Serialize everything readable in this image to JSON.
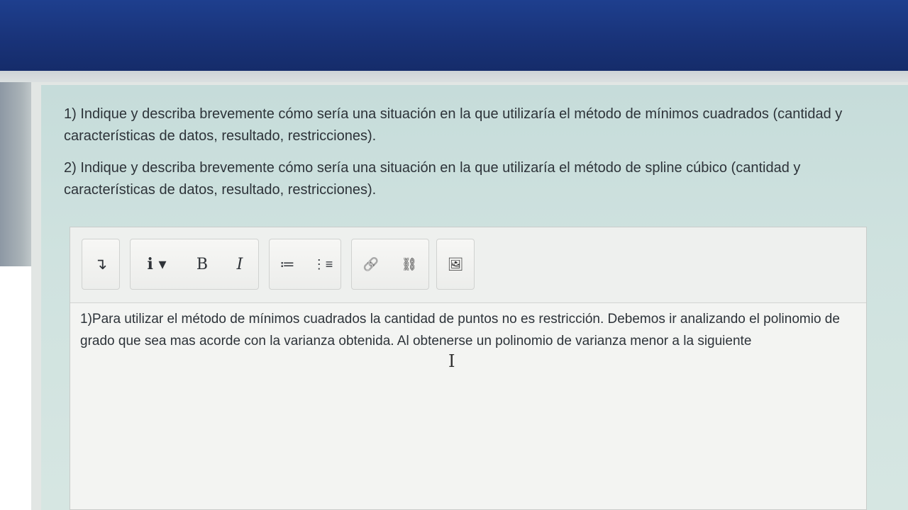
{
  "questions": [
    "1) Indique y describa brevemente cómo sería una situación en la que utilizaría el método de mínimos cuadrados (cantidad y características de datos, resultado, restricciones).",
    "2) Indique y describa brevemente cómo sería una situación en la que utilizaría el método de spline cúbico (cantidad y características de datos, resultado, restricciones)."
  ],
  "toolbar": {
    "collapse_icon": "↴",
    "info_label": "i ▾",
    "bold_label": "B",
    "italic_label": "I",
    "unordered_list_icon": "≔",
    "ordered_list_icon": "⋮≡",
    "link_icon": "🔗",
    "unlink_icon": "⛓",
    "image_icon": "🖼"
  },
  "editor": {
    "answer_text": "1)Para utilizar el método de mínimos cuadrados la cantidad de puntos no es restricción. Debemos ir analizando el polinomio de grado que sea mas acorde con la varianza obtenida. Al obtenerse un polinomio de varianza menor a la siguiente"
  }
}
